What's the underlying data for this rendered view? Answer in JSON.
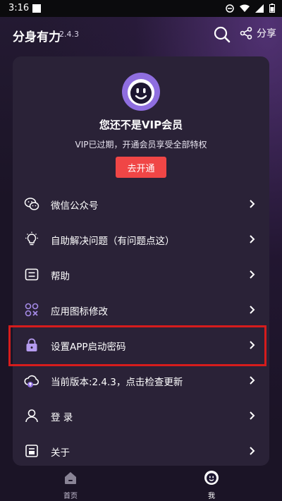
{
  "status_bar": {
    "time": "3:16"
  },
  "header": {
    "title": "分身有力",
    "version": "2.4.3",
    "share_label": "分享"
  },
  "vip": {
    "title": "您还不是VIP会员",
    "subtitle": "VIP已过期，开通会员享受全部特权",
    "button_label": "去开通"
  },
  "menu": {
    "items": [
      {
        "label": "微信公众号",
        "icon": "wechat-icon"
      },
      {
        "label": "自助解决问题（有问题点这）",
        "icon": "lightbulb-icon"
      },
      {
        "label": "帮助",
        "icon": "help-doc-icon"
      },
      {
        "label": "应用图标修改",
        "icon": "app-icon-grid-icon"
      },
      {
        "label": "设置APP启动密码",
        "icon": "lock-icon"
      },
      {
        "label": "当前版本:2.4.3，点击检查更新",
        "icon": "cloud-update-icon"
      },
      {
        "label": "登 录",
        "icon": "user-icon"
      },
      {
        "label": "关于",
        "icon": "about-icon"
      }
    ]
  },
  "bottom_nav": {
    "home_label": "首页",
    "me_label": "我"
  },
  "colors": {
    "background": "#1b1426",
    "card": "#2a2237",
    "accent_purple": "#8f6ee0",
    "button_red": "#f04646",
    "highlight_red": "#d61c1c"
  }
}
